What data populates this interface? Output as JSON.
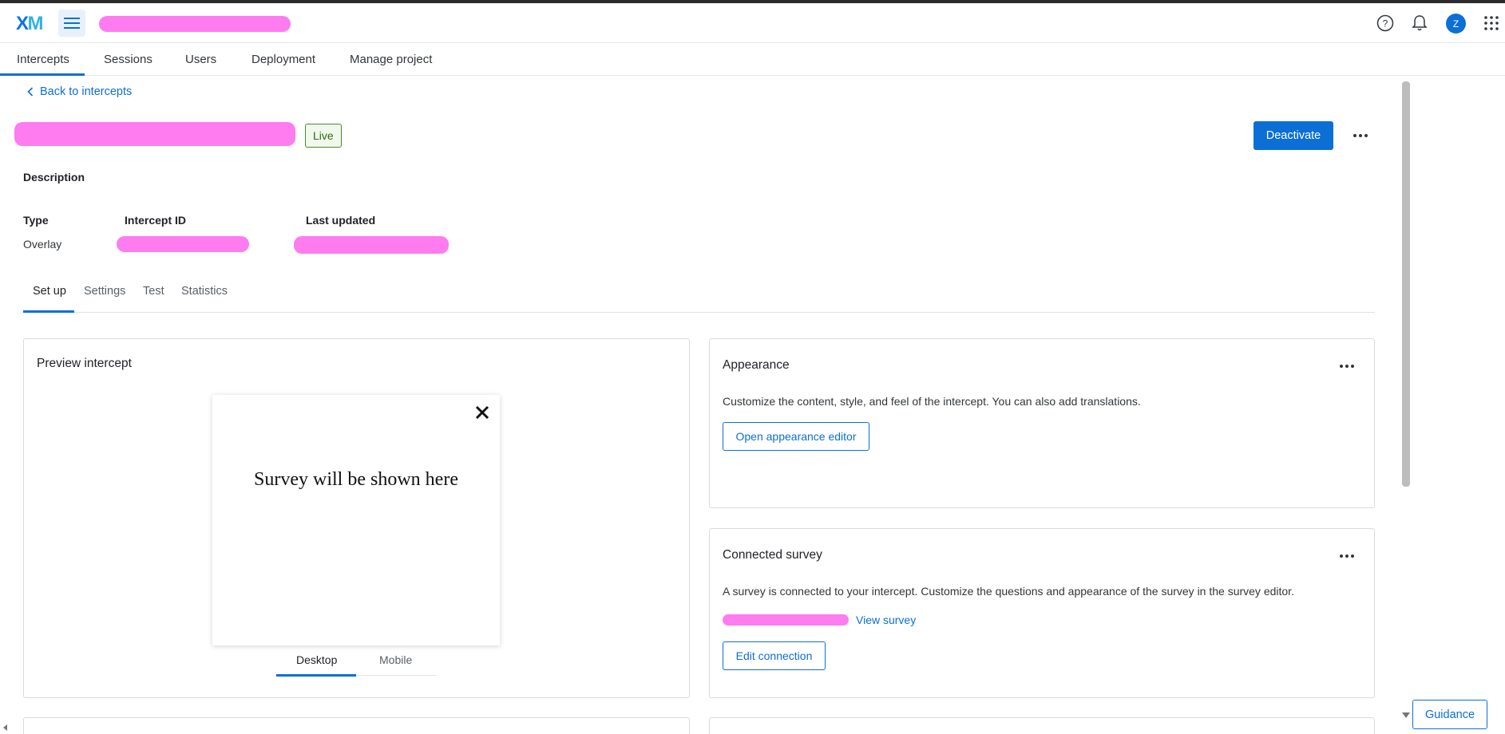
{
  "header": {
    "logo": "XM",
    "project_name_redacted": true
  },
  "primary_nav": {
    "tabs": [
      {
        "label": "Intercepts",
        "active": true
      },
      {
        "label": "Sessions"
      },
      {
        "label": "Users"
      },
      {
        "label": "Deployment"
      },
      {
        "label": "Manage project"
      }
    ]
  },
  "page": {
    "back_label": "Back to intercepts",
    "status_badge": "Live",
    "deactivate_label": "Deactivate",
    "description_label": "Description",
    "meta": {
      "type_label": "Type",
      "type_value": "Overlay",
      "intercept_id_label": "Intercept ID",
      "last_updated_label": "Last updated"
    },
    "sub_tabs": [
      {
        "label": "Set up",
        "active": true
      },
      {
        "label": "Settings"
      },
      {
        "label": "Test"
      },
      {
        "label": "Statistics"
      }
    ]
  },
  "preview_card": {
    "title": "Preview intercept",
    "placeholder_text": "Survey will be shown here",
    "device_tabs": [
      {
        "label": "Desktop",
        "active": true
      },
      {
        "label": "Mobile"
      }
    ]
  },
  "appearance_card": {
    "title": "Appearance",
    "text": "Customize the content, style, and feel of the intercept. You can also add translations.",
    "button_label": "Open appearance editor"
  },
  "connected_survey_card": {
    "title": "Connected survey",
    "text": "A survey is connected to your intercept. Customize the questions and appearance of the survey in the survey editor.",
    "view_survey_label": "View survey",
    "button_label": "Edit connection"
  },
  "guidance_label": "Guidance",
  "user_initial": "Z",
  "colors": {
    "accent": "#0b6fd6",
    "live_badge_border": "#4a8a2a",
    "redaction": "#ff7bf0"
  }
}
